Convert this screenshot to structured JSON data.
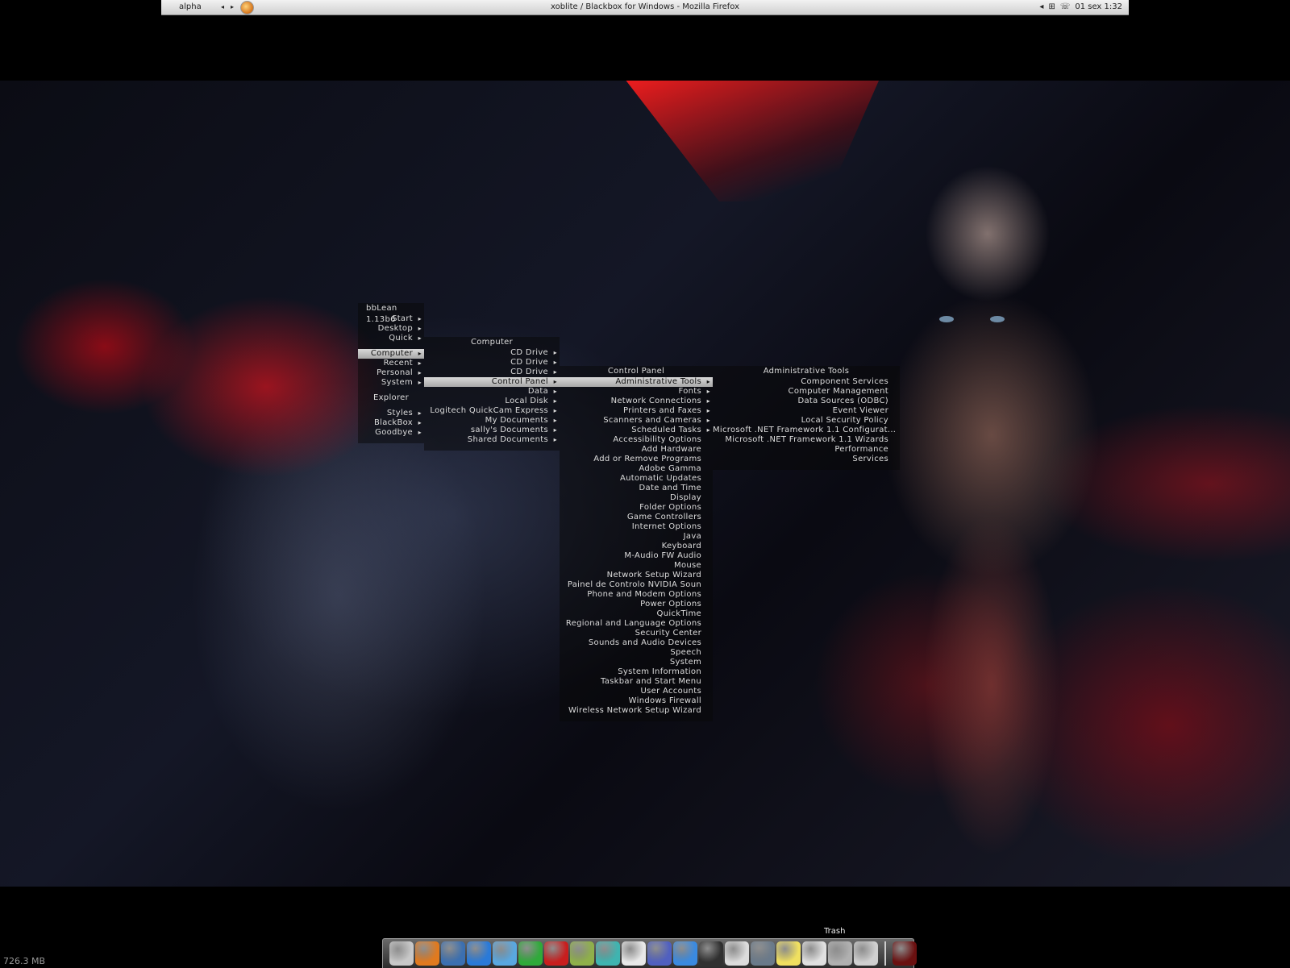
{
  "toolbar": {
    "workspace": "alpha",
    "prev_arrow": "◂",
    "next_arrow": "▸",
    "window_title": "xoblite / Blackbox for Windows - Mozilla Firefox",
    "tray_icons": [
      "network-icon",
      "phone-icon"
    ],
    "clock": "01 sex 1:32"
  },
  "menus": {
    "root": {
      "title": "bbLean 1.13b6",
      "items": [
        {
          "label": "Start",
          "sub": true
        },
        {
          "label": "Desktop",
          "sub": true
        },
        {
          "label": "Quick",
          "sub": true
        },
        {
          "label": "Computer",
          "sub": true,
          "highlighted": true
        },
        {
          "label": "Recent",
          "sub": true
        },
        {
          "label": "Personal",
          "sub": true
        },
        {
          "label": "System",
          "sub": true
        },
        {
          "label": "Explorer",
          "sub": false
        },
        {
          "label": "Styles",
          "sub": true
        },
        {
          "label": "BlackBox",
          "sub": true
        },
        {
          "label": "Goodbye",
          "sub": true
        }
      ]
    },
    "computer": {
      "title": "Computer",
      "items": [
        {
          "label": "CD Drive",
          "sub": true
        },
        {
          "label": "CD Drive",
          "sub": true
        },
        {
          "label": "CD Drive",
          "sub": true
        },
        {
          "label": "Control Panel",
          "sub": true,
          "highlighted": true
        },
        {
          "label": "Data",
          "sub": true
        },
        {
          "label": "Local Disk",
          "sub": true
        },
        {
          "label": "Logitech QuickCam Express",
          "sub": true
        },
        {
          "label": "My Documents",
          "sub": true
        },
        {
          "label": "sally's Documents",
          "sub": true
        },
        {
          "label": "Shared Documents",
          "sub": true
        }
      ]
    },
    "control_panel": {
      "title": "Control Panel",
      "items": [
        {
          "label": "Administrative Tools",
          "sub": true,
          "highlighted": true
        },
        {
          "label": "Fonts",
          "sub": true
        },
        {
          "label": "Network Connections",
          "sub": true
        },
        {
          "label": "Printers and Faxes",
          "sub": true
        },
        {
          "label": "Scanners and Cameras",
          "sub": true
        },
        {
          "label": "Scheduled Tasks",
          "sub": true
        },
        {
          "label": "Accessibility Options",
          "sub": false
        },
        {
          "label": "Add Hardware",
          "sub": false
        },
        {
          "label": "Add or Remove Programs",
          "sub": false
        },
        {
          "label": "Adobe Gamma",
          "sub": false
        },
        {
          "label": "Automatic Updates",
          "sub": false
        },
        {
          "label": "Date and Time",
          "sub": false
        },
        {
          "label": "Display",
          "sub": false
        },
        {
          "label": "Folder Options",
          "sub": false
        },
        {
          "label": "Game Controllers",
          "sub": false
        },
        {
          "label": "Internet Options",
          "sub": false
        },
        {
          "label": "Java",
          "sub": false
        },
        {
          "label": "Keyboard",
          "sub": false
        },
        {
          "label": "M-Audio FW Audio",
          "sub": false
        },
        {
          "label": "Mouse",
          "sub": false
        },
        {
          "label": "Network Setup Wizard",
          "sub": false
        },
        {
          "label": "Painel de Controlo NVIDIA Soun",
          "sub": false
        },
        {
          "label": "Phone and Modem Options",
          "sub": false
        },
        {
          "label": "Power Options",
          "sub": false
        },
        {
          "label": "QuickTime",
          "sub": false
        },
        {
          "label": "Regional and Language Options",
          "sub": false
        },
        {
          "label": "Security Center",
          "sub": false
        },
        {
          "label": "Sounds and Audio Devices",
          "sub": false
        },
        {
          "label": "Speech",
          "sub": false
        },
        {
          "label": "System",
          "sub": false
        },
        {
          "label": "System Information",
          "sub": false
        },
        {
          "label": "Taskbar and Start Menu",
          "sub": false
        },
        {
          "label": "User Accounts",
          "sub": false
        },
        {
          "label": "Windows Firewall",
          "sub": false
        },
        {
          "label": "Wireless Network Setup Wizard",
          "sub": false
        }
      ]
    },
    "admin_tools": {
      "title": "Administrative Tools",
      "items": [
        {
          "label": "Component Services",
          "sub": false
        },
        {
          "label": "Computer Management",
          "sub": false
        },
        {
          "label": "Data Sources (ODBC)",
          "sub": false
        },
        {
          "label": "Event Viewer",
          "sub": false
        },
        {
          "label": "Local Security Policy",
          "sub": false
        },
        {
          "label": "Microsoft .NET Framework 1.1 Configurat...",
          "sub": false
        },
        {
          "label": "Microsoft .NET Framework 1.1 Wizards",
          "sub": false
        },
        {
          "label": "Performance",
          "sub": false
        },
        {
          "label": "Services",
          "sub": false
        }
      ]
    }
  },
  "dock": {
    "hover_label": "Trash",
    "icons": [
      {
        "name": "hard-drive-icon",
        "color": "#c8c8c8"
      },
      {
        "name": "firefox-icon",
        "color": "#e07a1f"
      },
      {
        "name": "thunderbird-icon",
        "color": "#3b6fb0"
      },
      {
        "name": "internet-explorer-icon",
        "color": "#2a7ad8"
      },
      {
        "name": "messenger-icon",
        "color": "#59a8e0"
      },
      {
        "name": "winamp-icon",
        "color": "#2faa3a"
      },
      {
        "name": "flash-icon",
        "color": "#c81e1e"
      },
      {
        "name": "editor-icon",
        "color": "#8fb04a"
      },
      {
        "name": "puzzle-icon",
        "color": "#3fb4b0"
      },
      {
        "name": "document-icon",
        "color": "#e8e8e8"
      },
      {
        "name": "network-icon",
        "color": "#5060c0"
      },
      {
        "name": "azureus-icon",
        "color": "#3a8ae0"
      },
      {
        "name": "live-icon",
        "color": "#303030"
      },
      {
        "name": "refresh-icon",
        "color": "#dcdcdc"
      },
      {
        "name": "pen-icon",
        "color": "#6a7a8a"
      },
      {
        "name": "notes-icon",
        "color": "#f0e060"
      },
      {
        "name": "mail-icon",
        "color": "#e0e0e0"
      },
      {
        "name": "apple-icon",
        "color": "#b0b0b0"
      },
      {
        "name": "trash-icon",
        "color": "#d0d0d0"
      },
      {
        "name": "window-preview-icon",
        "color": "#6a1010"
      }
    ]
  },
  "status": {
    "memory": "726.3 MB"
  },
  "colors": {
    "menu_highlight": "#c0c0c0",
    "menu_text": "#dcdcdc",
    "toolbar_bg": "#e0e0e0"
  }
}
